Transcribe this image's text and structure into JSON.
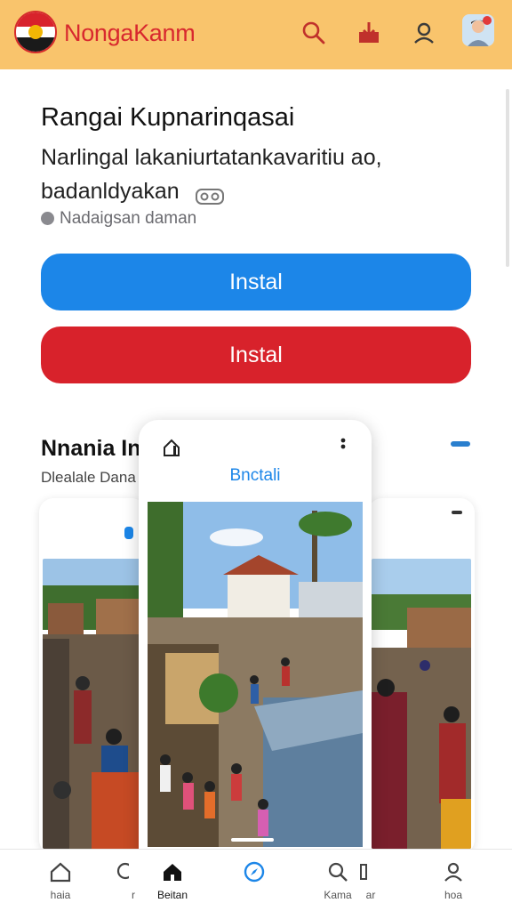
{
  "header": {
    "brand": "NongaKanm",
    "background": "#f9c46c",
    "brand_color": "#d8282e",
    "icons": [
      "search-icon",
      "download-icon",
      "user-icon",
      "avatar"
    ]
  },
  "app": {
    "title": "Rangai Kupnarinqasai",
    "subtitle": "Narlingal lakaniurtatankavaritiu ao, badanldyakan",
    "meta": "Nadaigsan daman",
    "install_primary": "Instal",
    "install_secondary": "Instal",
    "primary_color": "#1c86e8",
    "secondary_color": "#d8222b"
  },
  "section": {
    "title": "Nnania In",
    "subtitle": "Dlealale Dana"
  },
  "preview": {
    "title": "Bnctali"
  },
  "bottom_nav": [
    {
      "label": "haia",
      "icon": "home-icon"
    },
    {
      "label": "r",
      "icon": "partial-icon"
    },
    {
      "label": "Beitan",
      "icon": "home-filled-icon"
    },
    {
      "label": "",
      "icon": "compass-icon"
    },
    {
      "label": "Kama",
      "icon": "search-icon"
    },
    {
      "label": "ar",
      "icon": "partial-icon"
    },
    {
      "label": "hoa",
      "icon": "person-icon"
    }
  ]
}
